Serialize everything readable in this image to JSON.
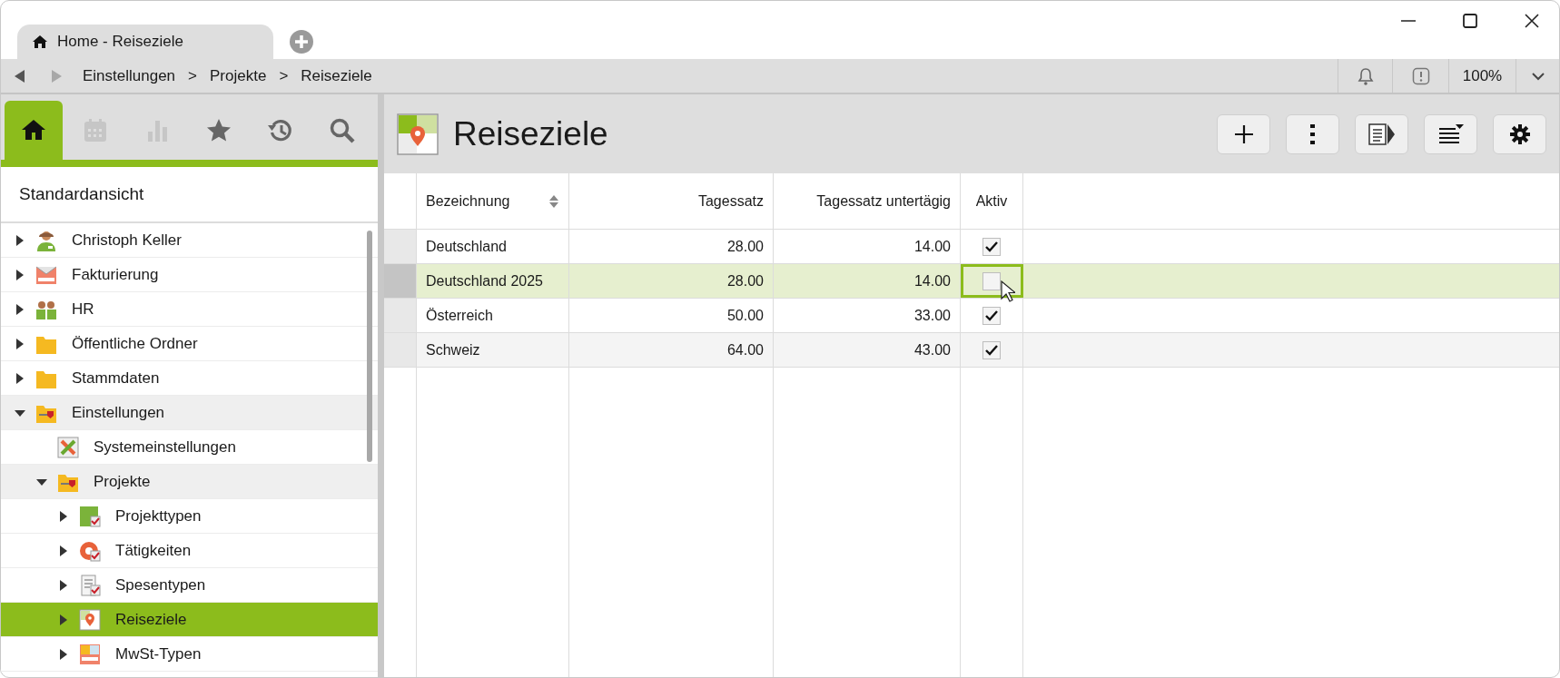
{
  "window": {
    "tab_title": "Home - Reiseziele"
  },
  "breadcrumb": [
    "Einstellungen",
    "Projekte",
    "Reiseziele"
  ],
  "breadcrumb_separators": [
    ">",
    ">"
  ],
  "zoom": "100%",
  "sidebar": {
    "tabs": [
      {
        "kind": "home",
        "selected": true,
        "disabled": false
      },
      {
        "kind": "calendar",
        "selected": false,
        "disabled": true
      },
      {
        "kind": "chart",
        "selected": false,
        "disabled": true
      },
      {
        "kind": "star",
        "selected": false,
        "disabled": false
      },
      {
        "kind": "history",
        "selected": false,
        "disabled": false
      },
      {
        "kind": "search",
        "selected": false,
        "disabled": false
      }
    ],
    "view_title": "Standardansicht",
    "tree": [
      {
        "label": "Christoph Keller",
        "kind": "person",
        "expandable": true,
        "expanded": false,
        "selected": false
      },
      {
        "label": "Fakturierung",
        "kind": "invoice",
        "expandable": true,
        "expanded": false,
        "selected": false
      },
      {
        "label": "HR",
        "kind": "group",
        "expandable": true,
        "expanded": false,
        "selected": false
      },
      {
        "label": "Öffentliche Ordner",
        "kind": "folder",
        "expandable": true,
        "expanded": false,
        "selected": false
      },
      {
        "label": "Stammdaten",
        "kind": "folder",
        "expandable": true,
        "expanded": false,
        "selected": false
      },
      {
        "label": "Einstellungen",
        "kind": "settings-folder",
        "expandable": true,
        "expanded": true,
        "selected": false,
        "children": [
          {
            "label": "Systemeinstellungen",
            "kind": "tools",
            "expandable": false,
            "expanded": false,
            "selected": false
          },
          {
            "label": "Projekte",
            "kind": "settings-folder",
            "expandable": true,
            "expanded": true,
            "selected": false,
            "children": [
              {
                "label": "Projekttypen",
                "kind": "project-type",
                "expandable": true,
                "expanded": false,
                "selected": false
              },
              {
                "label": "Tätigkeiten",
                "kind": "activity",
                "expandable": true,
                "expanded": false,
                "selected": false
              },
              {
                "label": "Spesentypen",
                "kind": "expense",
                "expandable": true,
                "expanded": false,
                "selected": false
              },
              {
                "label": "Reiseziele",
                "kind": "destination",
                "expandable": true,
                "expanded": false,
                "selected": true
              },
              {
                "label": "MwSt-Typen",
                "kind": "tax",
                "expandable": true,
                "expanded": false,
                "selected": false
              }
            ]
          }
        ]
      }
    ]
  },
  "page": {
    "title": "Reiseziele"
  },
  "table": {
    "columns": [
      {
        "label": "Bezeichnung",
        "sortable": true
      },
      {
        "label": "Tagessatz",
        "sortable": false
      },
      {
        "label": "Tagessatz untertägig",
        "sortable": false
      },
      {
        "label": "Aktiv",
        "sortable": false
      }
    ],
    "rows": [
      {
        "name": "Deutschland",
        "rate": "28.00",
        "partial_rate": "14.00",
        "active": true,
        "selected": false
      },
      {
        "name": "Deutschland 2025",
        "rate": "28.00",
        "partial_rate": "14.00",
        "active": false,
        "selected": true
      },
      {
        "name": "Österreich",
        "rate": "50.00",
        "partial_rate": "33.00",
        "active": true,
        "selected": false
      },
      {
        "name": "Schweiz",
        "rate": "64.00",
        "partial_rate": "43.00",
        "active": true,
        "selected": false
      }
    ]
  }
}
